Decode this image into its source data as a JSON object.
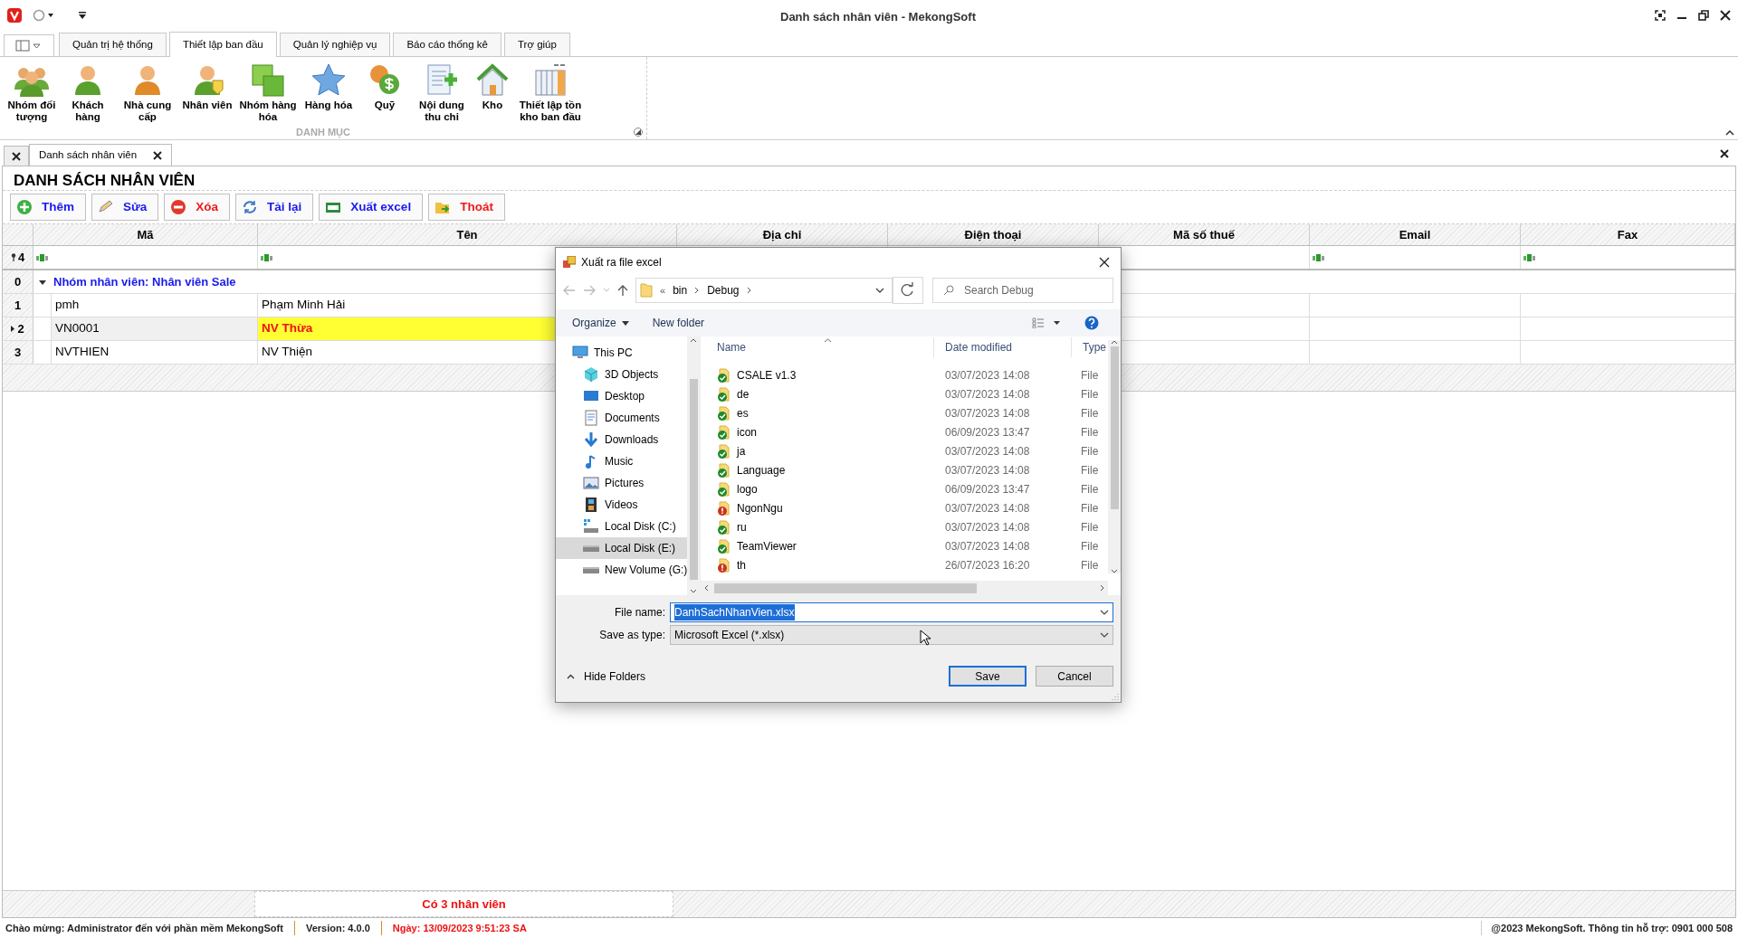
{
  "window": {
    "title": "Danh sách nhân viên - MekongSoft"
  },
  "ribbon_tabs": [
    {
      "label": "Quản trị hệ thống",
      "selected": false
    },
    {
      "label": "Thiết lập ban đầu",
      "selected": true
    },
    {
      "label": "Quản lý nghiệp vụ",
      "selected": false
    },
    {
      "label": "Báo cáo thống kê",
      "selected": false
    },
    {
      "label": "Trợ giúp",
      "selected": false
    }
  ],
  "ribbon_group": {
    "label": "DANH MỤC",
    "items": [
      {
        "label": "Nhóm đối tượng",
        "kind": "people"
      },
      {
        "label": "Khách hàng",
        "kind": "person"
      },
      {
        "label": "Nhà cung cấp",
        "kind": "supplier"
      },
      {
        "label": "Nhân viên",
        "kind": "employee"
      },
      {
        "label": "Nhóm hàng hóa",
        "kind": "squares"
      },
      {
        "label": "Hàng hóa",
        "kind": "star"
      },
      {
        "label": "Quỹ",
        "kind": "coins"
      },
      {
        "label": "Nội dung thu chi",
        "kind": "document"
      },
      {
        "label": "Kho",
        "kind": "house"
      },
      {
        "label": "Thiết lập tồn kho ban đầu",
        "kind": "columns"
      }
    ]
  },
  "document_tabs": [
    {
      "label": "Danh sách nhân viên",
      "selected": true
    }
  ],
  "heading": "DANH SÁCH NHÂN VIÊN",
  "toolbar": [
    {
      "label": "Thêm",
      "kind": "add"
    },
    {
      "label": "Sửa",
      "kind": "edit"
    },
    {
      "label": "Xóa",
      "kind": "delete"
    },
    {
      "label": "Tải lại",
      "kind": "reload"
    },
    {
      "label": "Xuất excel",
      "kind": "export"
    },
    {
      "label": "Thoát",
      "kind": "exit"
    }
  ],
  "grid": {
    "columns": [
      "Mã",
      "Tên",
      "Địa chỉ",
      "Điện thoại",
      "Mã số thuế",
      "Email",
      "Fax"
    ],
    "filter_row_label": "4",
    "group": {
      "index": "0",
      "label": "Nhóm nhân viên: Nhân viên Sale",
      "expanded": true
    },
    "rows": [
      {
        "index": "1",
        "code": "pmh",
        "name": "Phạm Minh Hải",
        "selected": false
      },
      {
        "index": "2",
        "code": "VN0001",
        "name": "NV Thừa",
        "selected": true
      },
      {
        "index": "3",
        "code": "NVTHIEN",
        "name": "NV Thiện",
        "selected": false
      }
    ],
    "footer": "Có 3 nhân viên"
  },
  "status_bar": {
    "items": [
      {
        "text": "Chào mừng: Administrator đến với phần mềm MekongSoft",
        "kind": "info"
      },
      {
        "text": "Version: 4.0.0",
        "kind": "info"
      },
      {
        "text": "Ngày: 13/09/2023 9:51:23 SA",
        "kind": "date"
      }
    ],
    "right": "@2023 MekongSoft. Thông tin hỗ trợ: 0901 000 508"
  },
  "dialog": {
    "title": "Xuất ra file excel",
    "path_overflow": "«",
    "path": [
      "bin",
      "Debug"
    ],
    "search": {
      "placeholder": "Search Debug"
    },
    "commands": [
      "Organize",
      "New folder"
    ],
    "nav": [
      {
        "label": "This PC",
        "kind": "pc",
        "selected": false,
        "children": [
          {
            "label": "3D Objects",
            "kind": "cube",
            "selected": false
          },
          {
            "label": "Desktop",
            "kind": "desktop",
            "selected": false
          },
          {
            "label": "Documents",
            "kind": "documents",
            "selected": false
          },
          {
            "label": "Downloads",
            "kind": "downloads",
            "selected": false
          },
          {
            "label": "Music",
            "kind": "music",
            "selected": false
          },
          {
            "label": "Pictures",
            "kind": "pictures",
            "selected": false
          },
          {
            "label": "Videos",
            "kind": "videos",
            "selected": false
          },
          {
            "label": "Local Disk (C:)",
            "kind": "system-disk",
            "selected": false
          },
          {
            "label": "Local Disk (E:)",
            "kind": "disk",
            "selected": true
          },
          {
            "label": "New Volume (G:)",
            "kind": "disk",
            "selected": false
          }
        ]
      }
    ],
    "columns": [
      "Name",
      "Date modified",
      "Type"
    ],
    "files": [
      {
        "name": "CSALE v1.3",
        "date": "03/07/2023 14:08",
        "type": "File",
        "sync_error": false
      },
      {
        "name": "de",
        "date": "03/07/2023 14:08",
        "type": "File",
        "sync_error": false
      },
      {
        "name": "es",
        "date": "03/07/2023 14:08",
        "type": "File",
        "sync_error": false
      },
      {
        "name": "icon",
        "date": "06/09/2023 13:47",
        "type": "File",
        "sync_error": false
      },
      {
        "name": "ja",
        "date": "03/07/2023 14:08",
        "type": "File",
        "sync_error": false
      },
      {
        "name": "Language",
        "date": "03/07/2023 14:08",
        "type": "File",
        "sync_error": false
      },
      {
        "name": "logo",
        "date": "06/09/2023 13:47",
        "type": "File",
        "sync_error": false
      },
      {
        "name": "NgonNgu",
        "date": "03/07/2023 14:08",
        "type": "File",
        "sync_error": true
      },
      {
        "name": "ru",
        "date": "03/07/2023 14:08",
        "type": "File",
        "sync_error": false
      },
      {
        "name": "TeamViewer",
        "date": "03/07/2023 14:08",
        "type": "File",
        "sync_error": false
      },
      {
        "name": "th",
        "date": "26/07/2023 16:20",
        "type": "File",
        "sync_error": true
      }
    ],
    "file_name": {
      "label": "File name:",
      "value": "DanhSachNhanVien.xlsx"
    },
    "save_type": {
      "label": "Save as type:",
      "value": "Microsoft Excel  (*.xlsx)"
    },
    "hide_folders": "Hide Folders",
    "buttons": [
      "Save",
      "Cancel"
    ]
  }
}
